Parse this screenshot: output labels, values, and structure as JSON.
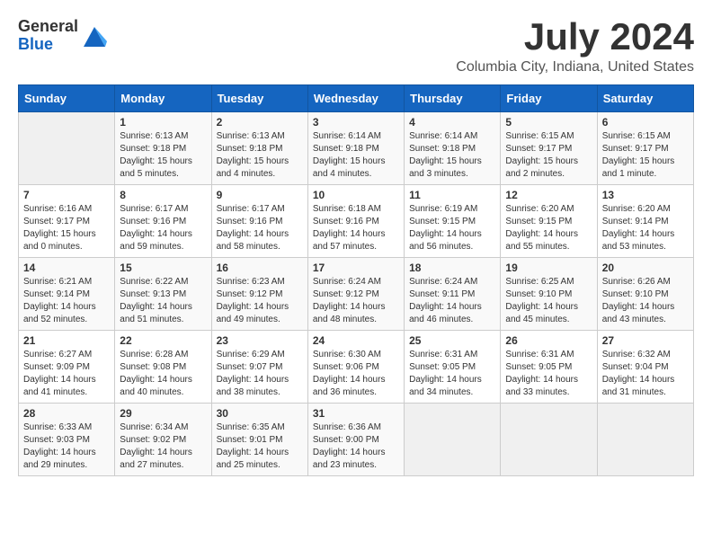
{
  "logo": {
    "general": "General",
    "blue": "Blue"
  },
  "title": "July 2024",
  "subtitle": "Columbia City, Indiana, United States",
  "days_of_week": [
    "Sunday",
    "Monday",
    "Tuesday",
    "Wednesday",
    "Thursday",
    "Friday",
    "Saturday"
  ],
  "weeks": [
    [
      {
        "day": "",
        "content": ""
      },
      {
        "day": "1",
        "content": "Sunrise: 6:13 AM\nSunset: 9:18 PM\nDaylight: 15 hours\nand 5 minutes."
      },
      {
        "day": "2",
        "content": "Sunrise: 6:13 AM\nSunset: 9:18 PM\nDaylight: 15 hours\nand 4 minutes."
      },
      {
        "day": "3",
        "content": "Sunrise: 6:14 AM\nSunset: 9:18 PM\nDaylight: 15 hours\nand 4 minutes."
      },
      {
        "day": "4",
        "content": "Sunrise: 6:14 AM\nSunset: 9:18 PM\nDaylight: 15 hours\nand 3 minutes."
      },
      {
        "day": "5",
        "content": "Sunrise: 6:15 AM\nSunset: 9:17 PM\nDaylight: 15 hours\nand 2 minutes."
      },
      {
        "day": "6",
        "content": "Sunrise: 6:15 AM\nSunset: 9:17 PM\nDaylight: 15 hours\nand 1 minute."
      }
    ],
    [
      {
        "day": "7",
        "content": "Sunrise: 6:16 AM\nSunset: 9:17 PM\nDaylight: 15 hours\nand 0 minutes."
      },
      {
        "day": "8",
        "content": "Sunrise: 6:17 AM\nSunset: 9:16 PM\nDaylight: 14 hours\nand 59 minutes."
      },
      {
        "day": "9",
        "content": "Sunrise: 6:17 AM\nSunset: 9:16 PM\nDaylight: 14 hours\nand 58 minutes."
      },
      {
        "day": "10",
        "content": "Sunrise: 6:18 AM\nSunset: 9:16 PM\nDaylight: 14 hours\nand 57 minutes."
      },
      {
        "day": "11",
        "content": "Sunrise: 6:19 AM\nSunset: 9:15 PM\nDaylight: 14 hours\nand 56 minutes."
      },
      {
        "day": "12",
        "content": "Sunrise: 6:20 AM\nSunset: 9:15 PM\nDaylight: 14 hours\nand 55 minutes."
      },
      {
        "day": "13",
        "content": "Sunrise: 6:20 AM\nSunset: 9:14 PM\nDaylight: 14 hours\nand 53 minutes."
      }
    ],
    [
      {
        "day": "14",
        "content": "Sunrise: 6:21 AM\nSunset: 9:14 PM\nDaylight: 14 hours\nand 52 minutes."
      },
      {
        "day": "15",
        "content": "Sunrise: 6:22 AM\nSunset: 9:13 PM\nDaylight: 14 hours\nand 51 minutes."
      },
      {
        "day": "16",
        "content": "Sunrise: 6:23 AM\nSunset: 9:12 PM\nDaylight: 14 hours\nand 49 minutes."
      },
      {
        "day": "17",
        "content": "Sunrise: 6:24 AM\nSunset: 9:12 PM\nDaylight: 14 hours\nand 48 minutes."
      },
      {
        "day": "18",
        "content": "Sunrise: 6:24 AM\nSunset: 9:11 PM\nDaylight: 14 hours\nand 46 minutes."
      },
      {
        "day": "19",
        "content": "Sunrise: 6:25 AM\nSunset: 9:10 PM\nDaylight: 14 hours\nand 45 minutes."
      },
      {
        "day": "20",
        "content": "Sunrise: 6:26 AM\nSunset: 9:10 PM\nDaylight: 14 hours\nand 43 minutes."
      }
    ],
    [
      {
        "day": "21",
        "content": "Sunrise: 6:27 AM\nSunset: 9:09 PM\nDaylight: 14 hours\nand 41 minutes."
      },
      {
        "day": "22",
        "content": "Sunrise: 6:28 AM\nSunset: 9:08 PM\nDaylight: 14 hours\nand 40 minutes."
      },
      {
        "day": "23",
        "content": "Sunrise: 6:29 AM\nSunset: 9:07 PM\nDaylight: 14 hours\nand 38 minutes."
      },
      {
        "day": "24",
        "content": "Sunrise: 6:30 AM\nSunset: 9:06 PM\nDaylight: 14 hours\nand 36 minutes."
      },
      {
        "day": "25",
        "content": "Sunrise: 6:31 AM\nSunset: 9:05 PM\nDaylight: 14 hours\nand 34 minutes."
      },
      {
        "day": "26",
        "content": "Sunrise: 6:31 AM\nSunset: 9:05 PM\nDaylight: 14 hours\nand 33 minutes."
      },
      {
        "day": "27",
        "content": "Sunrise: 6:32 AM\nSunset: 9:04 PM\nDaylight: 14 hours\nand 31 minutes."
      }
    ],
    [
      {
        "day": "28",
        "content": "Sunrise: 6:33 AM\nSunset: 9:03 PM\nDaylight: 14 hours\nand 29 minutes."
      },
      {
        "day": "29",
        "content": "Sunrise: 6:34 AM\nSunset: 9:02 PM\nDaylight: 14 hours\nand 27 minutes."
      },
      {
        "day": "30",
        "content": "Sunrise: 6:35 AM\nSunset: 9:01 PM\nDaylight: 14 hours\nand 25 minutes."
      },
      {
        "day": "31",
        "content": "Sunrise: 6:36 AM\nSunset: 9:00 PM\nDaylight: 14 hours\nand 23 minutes."
      },
      {
        "day": "",
        "content": ""
      },
      {
        "day": "",
        "content": ""
      },
      {
        "day": "",
        "content": ""
      }
    ]
  ]
}
